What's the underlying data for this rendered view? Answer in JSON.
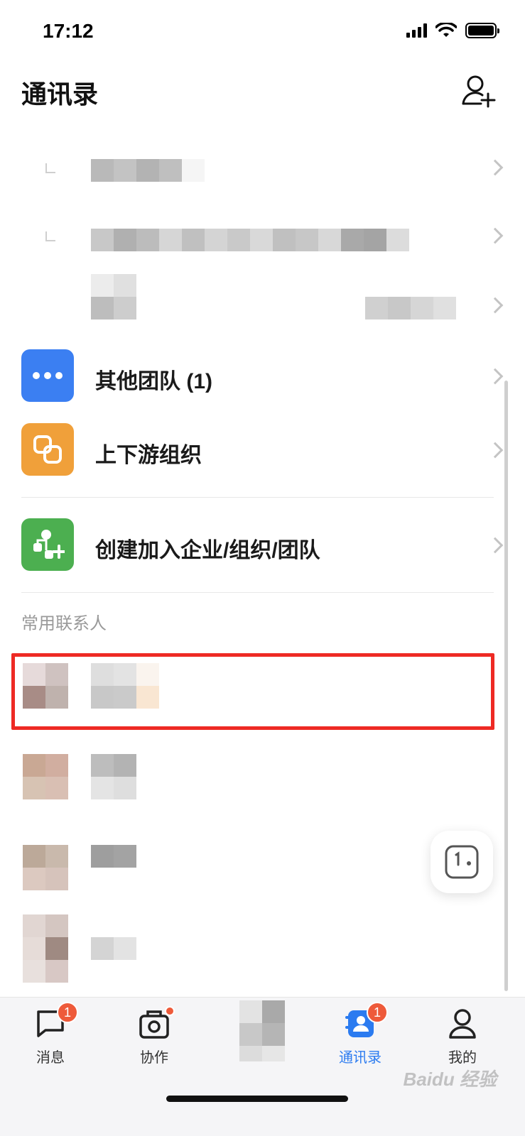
{
  "status_bar": {
    "time": "17:12"
  },
  "header": {
    "title": "通讯录",
    "add_contact_icon": "person-add-icon"
  },
  "menu": {
    "items": [
      {
        "label": "其他团队 (1)",
        "icon": "more-dots-icon",
        "color": "#3b7ff2"
      },
      {
        "label": "上下游组织",
        "icon": "link-icon",
        "color": "#f0a03a"
      },
      {
        "label": "创建加入企业/组织/团队",
        "icon": "org-add-icon",
        "color": "#4caf50"
      }
    ]
  },
  "section": {
    "frequent_contacts_label": "常用联系人"
  },
  "tab_bar": {
    "tabs": [
      {
        "label": "消息",
        "icon": "chat-icon",
        "badge": "1"
      },
      {
        "label": "协作",
        "icon": "collab-icon",
        "badge_dot": true
      },
      {
        "label": "",
        "icon": "blurred-icon"
      },
      {
        "label": "通讯录",
        "icon": "contacts-icon",
        "badge": "1",
        "active": true
      },
      {
        "label": "我的",
        "icon": "profile-icon"
      }
    ]
  },
  "colors": {
    "accent": "#2b7bf0",
    "highlight": "#ee2a24",
    "badge": "#ee5a3a"
  },
  "watermark": "Baidu 经验"
}
